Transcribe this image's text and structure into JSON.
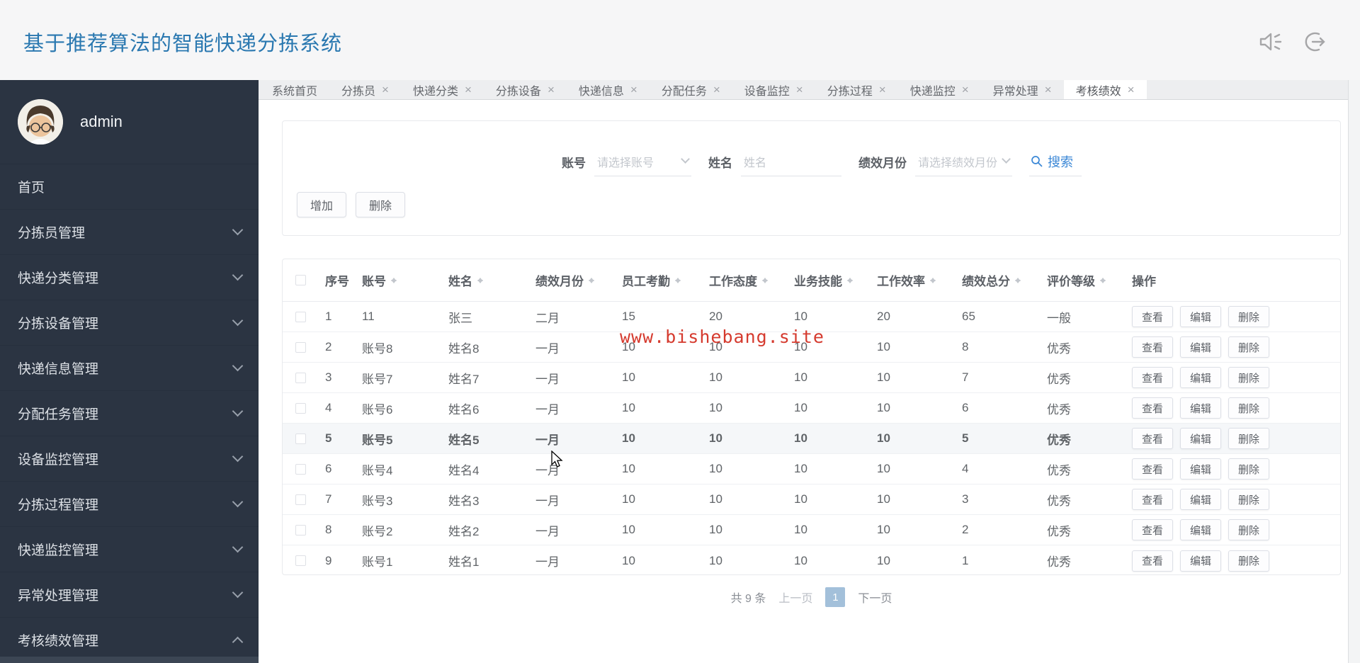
{
  "header": {
    "title": "基于推荐算法的智能快递分拣系统",
    "icons": [
      {
        "name": "speaker-icon"
      },
      {
        "name": "logout-icon"
      }
    ]
  },
  "sidebar": {
    "username": "admin",
    "items": [
      {
        "label": "首页",
        "chevron": "none"
      },
      {
        "label": "分拣员管理",
        "chevron": "down"
      },
      {
        "label": "快递分类管理",
        "chevron": "down"
      },
      {
        "label": "分拣设备管理",
        "chevron": "down"
      },
      {
        "label": "快递信息管理",
        "chevron": "down"
      },
      {
        "label": "分配任务管理",
        "chevron": "down"
      },
      {
        "label": "设备监控管理",
        "chevron": "down"
      },
      {
        "label": "分拣过程管理",
        "chevron": "down"
      },
      {
        "label": "快递监控管理",
        "chevron": "down"
      },
      {
        "label": "异常处理管理",
        "chevron": "down"
      },
      {
        "label": "考核绩效管理",
        "chevron": "up"
      }
    ]
  },
  "tabs": [
    {
      "label": "系统首页",
      "closable": false,
      "active": false
    },
    {
      "label": "分拣员",
      "closable": true,
      "active": false
    },
    {
      "label": "快递分类",
      "closable": true,
      "active": false
    },
    {
      "label": "分拣设备",
      "closable": true,
      "active": false
    },
    {
      "label": "快递信息",
      "closable": true,
      "active": false
    },
    {
      "label": "分配任务",
      "closable": true,
      "active": false
    },
    {
      "label": "设备监控",
      "closable": true,
      "active": false
    },
    {
      "label": "分拣过程",
      "closable": true,
      "active": false
    },
    {
      "label": "快递监控",
      "closable": true,
      "active": false
    },
    {
      "label": "异常处理",
      "closable": true,
      "active": false
    },
    {
      "label": "考核绩效",
      "closable": true,
      "active": true
    }
  ],
  "search_form": {
    "account_label": "账号",
    "account_placeholder": "请选择账号",
    "name_label": "姓名",
    "name_placeholder": "姓名",
    "month_label": "绩效月份",
    "month_placeholder": "请选择绩效月份",
    "search_label": "搜索"
  },
  "toolbar": {
    "add_label": "增加",
    "delete_label": "删除"
  },
  "table": {
    "columns": [
      {
        "label": "序号",
        "sortable": false
      },
      {
        "label": "账号",
        "sortable": true
      },
      {
        "label": "姓名",
        "sortable": true
      },
      {
        "label": "绩效月份",
        "sortable": true
      },
      {
        "label": "员工考勤",
        "sortable": true
      },
      {
        "label": "工作态度",
        "sortable": true
      },
      {
        "label": "业务技能",
        "sortable": true
      },
      {
        "label": "工作效率",
        "sortable": true
      },
      {
        "label": "绩效总分",
        "sortable": true
      },
      {
        "label": "评价等级",
        "sortable": true
      },
      {
        "label": "操作",
        "sortable": false
      }
    ],
    "action_labels": [
      "查看",
      "编辑",
      "删除"
    ],
    "rows": [
      {
        "cells": [
          "1",
          "11",
          "张三",
          "二月",
          "15",
          "20",
          "10",
          "20",
          "65",
          "一般"
        ],
        "highlighted": false
      },
      {
        "cells": [
          "2",
          "账号8",
          "姓名8",
          "一月",
          "10",
          "10",
          "10",
          "10",
          "8",
          "优秀"
        ],
        "highlighted": false
      },
      {
        "cells": [
          "3",
          "账号7",
          "姓名7",
          "一月",
          "10",
          "10",
          "10",
          "10",
          "7",
          "优秀"
        ],
        "highlighted": false
      },
      {
        "cells": [
          "4",
          "账号6",
          "姓名6",
          "一月",
          "10",
          "10",
          "10",
          "10",
          "6",
          "优秀"
        ],
        "highlighted": false
      },
      {
        "cells": [
          "5",
          "账号5",
          "姓名5",
          "一月",
          "10",
          "10",
          "10",
          "10",
          "5",
          "优秀"
        ],
        "highlighted": true
      },
      {
        "cells": [
          "6",
          "账号4",
          "姓名4",
          "一月",
          "10",
          "10",
          "10",
          "10",
          "4",
          "优秀"
        ],
        "highlighted": false
      },
      {
        "cells": [
          "7",
          "账号3",
          "姓名3",
          "一月",
          "10",
          "10",
          "10",
          "10",
          "3",
          "优秀"
        ],
        "highlighted": false
      },
      {
        "cells": [
          "8",
          "账号2",
          "姓名2",
          "一月",
          "10",
          "10",
          "10",
          "10",
          "2",
          "优秀"
        ],
        "highlighted": false
      },
      {
        "cells": [
          "9",
          "账号1",
          "姓名1",
          "一月",
          "10",
          "10",
          "10",
          "10",
          "1",
          "优秀"
        ],
        "highlighted": false
      }
    ]
  },
  "pagination": {
    "total": "共 9 条",
    "prev": "上一页",
    "current": "1",
    "next": "下一页"
  },
  "watermark": "www.bishebang.site",
  "colors": {
    "title_blue": "#2a78b0",
    "sidebar_bg": "#2b3442",
    "accent_blue": "#3a87d6",
    "active_page_bg": "#a3c0da",
    "watermark_red": "#d53a2e"
  }
}
